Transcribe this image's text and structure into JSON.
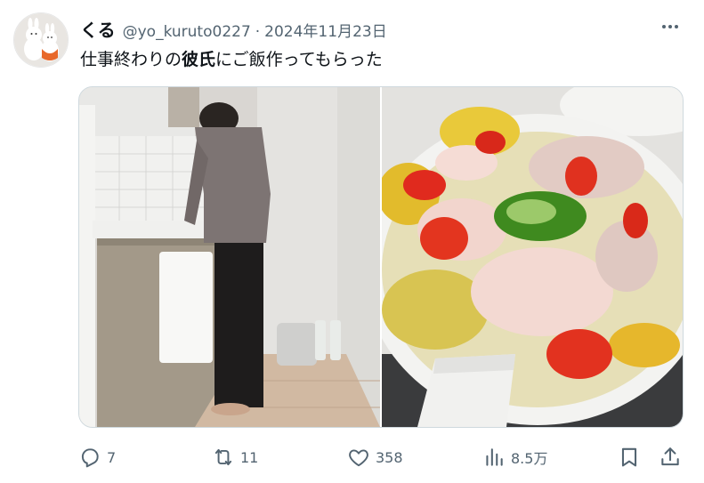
{
  "post": {
    "display_name": "くる",
    "handle": "@yo_kuruto0227",
    "separator": "·",
    "date": "2024年11月23日",
    "text_before": "仕事終わりの",
    "text_bold": "彼氏",
    "text_after": "にご飯作ってもらった"
  },
  "actions": {
    "reply_count": "7",
    "repost_count": "11",
    "like_count": "358",
    "views_count": "8.5万"
  },
  "icons": {
    "avatar": "avatar-bunny-figures",
    "more": "more-horizontal-icon",
    "reply": "reply-icon",
    "repost": "repost-icon",
    "like": "heart-icon",
    "views": "views-bar-chart-icon",
    "bookmark": "bookmark-icon",
    "share": "share-icon"
  },
  "colors": {
    "text_primary": "#0f1419",
    "text_secondary": "#536471",
    "border": "#cfd9de"
  }
}
